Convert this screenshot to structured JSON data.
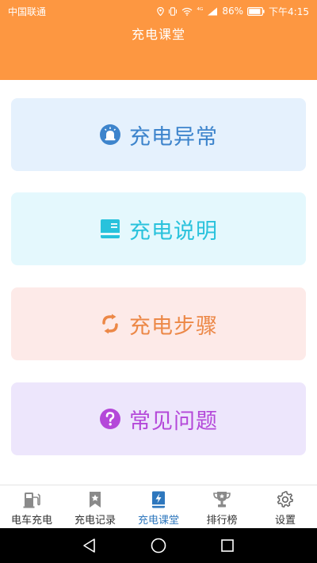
{
  "status_bar": {
    "carrier": "中国联通",
    "battery": "86%",
    "signal_label": "⁴ᴳ",
    "time": "下午4:15"
  },
  "header": {
    "title": "充电课堂"
  },
  "cards": [
    {
      "label": "充电异常",
      "icon": "alarm-icon",
      "color": "#3d84cc"
    },
    {
      "label": "充电说明",
      "icon": "manual-icon",
      "color": "#29c2dc"
    },
    {
      "label": "充电步骤",
      "icon": "refresh-arrows-icon",
      "color": "#ec8847"
    },
    {
      "label": "常见问题",
      "icon": "question-icon",
      "color": "#b448d9"
    }
  ],
  "tabs": [
    {
      "label": "电车充电",
      "icon": "charging-station-icon",
      "active": false
    },
    {
      "label": "充电记录",
      "icon": "bookmark-star-icon",
      "active": false
    },
    {
      "label": "充电课堂",
      "icon": "lightning-book-icon",
      "active": true
    },
    {
      "label": "排行榜",
      "icon": "trophy-icon",
      "active": false
    },
    {
      "label": "设置",
      "icon": "gear-icon",
      "active": false
    }
  ],
  "colors": {
    "header_bg": "#fd9741",
    "active_tab": "#2e77bd",
    "inactive_icon": "#8a8a8a"
  }
}
